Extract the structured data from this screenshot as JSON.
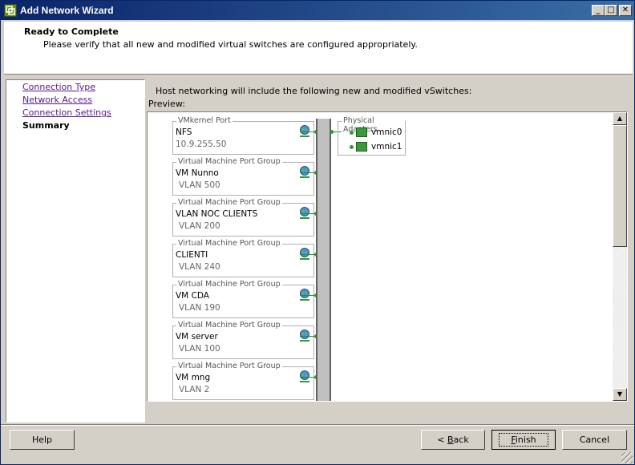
{
  "window": {
    "title": "Add Network Wizard",
    "controls": {
      "minimize": "_",
      "maximize": "□",
      "close": "✕"
    }
  },
  "header": {
    "title": "Ready to Complete",
    "subtitle": "Please verify that all new and modified virtual switches are configured appropriately."
  },
  "sidebar": {
    "items": [
      {
        "label": "Connection Type",
        "state": "visited"
      },
      {
        "label": "Network Access",
        "state": "visited"
      },
      {
        "label": "Connection Settings",
        "state": "visited"
      },
      {
        "label": "Summary",
        "state": "current"
      }
    ]
  },
  "main": {
    "intro": "Host networking will include the following new and modified vSwitches:",
    "preview_label": "Preview:",
    "port_groups": [
      {
        "caption": "VMkernel Port",
        "name": "NFS",
        "value": "10.9.255.50"
      },
      {
        "caption": "Virtual Machine Port Group",
        "name": "VM Nunno",
        "value": "VLAN 500"
      },
      {
        "caption": "Virtual Machine Port Group",
        "name": "VLAN NOC CLIENTS",
        "value": "VLAN 200"
      },
      {
        "caption": "Virtual Machine Port Group",
        "name": "CLIENTI",
        "value": "VLAN 240"
      },
      {
        "caption": "Virtual Machine Port Group",
        "name": "VM CDA",
        "value": "VLAN 190"
      },
      {
        "caption": "Virtual Machine Port Group",
        "name": "VM server",
        "value": "VLAN 100"
      },
      {
        "caption": "Virtual Machine Port Group",
        "name": "VM mng",
        "value": "VLAN 2"
      }
    ],
    "physical_adapters": {
      "caption": "Physical Adapters",
      "nics": [
        "vmnic0",
        "vmnic1"
      ]
    }
  },
  "buttons": {
    "help": "Help",
    "back_prefix": "< ",
    "back_mnemonic": "B",
    "back_rest": "ack",
    "finish_mnemonic": "F",
    "finish_rest": "inish",
    "cancel": "Cancel"
  },
  "colors": {
    "title_bar": "#0a246a",
    "link": "#551a8b",
    "connector": "#2a9d2a"
  }
}
